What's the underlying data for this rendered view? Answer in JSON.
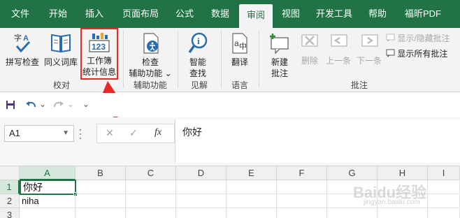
{
  "tabs": [
    {
      "label": "文件"
    },
    {
      "label": "开始"
    },
    {
      "label": "插入"
    },
    {
      "label": "页面布局"
    },
    {
      "label": "公式"
    },
    {
      "label": "数据"
    },
    {
      "label": "审阅"
    },
    {
      "label": "视图"
    },
    {
      "label": "开发工具"
    },
    {
      "label": "帮助"
    },
    {
      "label": "福昕PDF"
    }
  ],
  "active_tab": "审阅",
  "ribbon": {
    "proofing": {
      "spell_check": "拼写检查",
      "thesaurus": "同义词库",
      "workbook_stats_line1": "工作簿",
      "workbook_stats_line2": "统计信息",
      "group_label": "校对"
    },
    "accessibility": {
      "check_line1": "检查",
      "check_line2": "辅助功能 ⌄",
      "group_label": "辅助功能"
    },
    "insights": {
      "smart_lookup_line1": "智能",
      "smart_lookup_line2": "查找",
      "group_label": "见解"
    },
    "language": {
      "translate": "翻译",
      "group_label": "语言"
    },
    "comments": {
      "new_comment_line1": "新建",
      "new_comment_line2": "批注",
      "delete": "删除",
      "previous": "上一条",
      "next": "下一条",
      "show_hide": "显示/隐藏批注",
      "show_all": "显示所有批注",
      "group_label": "批注"
    },
    "workbook_stats_icon_text": "123"
  },
  "qat": {
    "undo_caret": "⌄",
    "redo_caret": "⌄",
    "more": "⌄"
  },
  "name_box": "A1",
  "fx_label": "fx",
  "formula_value": "你好",
  "columns": [
    "A",
    "B",
    "C",
    "D",
    "E",
    "F",
    "G",
    "H",
    "I"
  ],
  "rows": [
    {
      "num": "1",
      "a": "你好"
    },
    {
      "num": "2",
      "a": "niha"
    },
    {
      "num": "3",
      "a": ""
    }
  ],
  "watermark": "Baidu经验",
  "watermark_sub": "jingyan.baidu.com",
  "colors": {
    "accent": "#217346",
    "highlight": "#e52a2a"
  }
}
